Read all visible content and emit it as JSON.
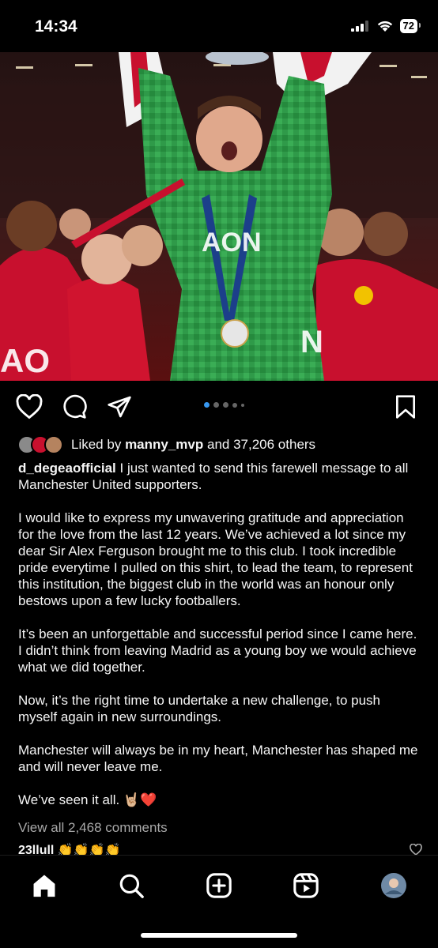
{
  "status_bar": {
    "time": "14:34",
    "battery": "72"
  },
  "post": {
    "image_alt": "Goalkeeper in green shirt lifting the trophy with teammates in red",
    "carousel": {
      "count": 5,
      "active_index": 0
    },
    "likes": {
      "prefix": "Liked by",
      "user": "manny_mvp",
      "suffix": "and 37,206 others"
    },
    "author": "d_degeaofficial",
    "caption_first": "I just wanted to send this farewell message to all Manchester United supporters.",
    "caption_paragraphs": [
      "I would like to express my unwavering gratitude and appreciation for the love from the last 12 years. We’ve achieved a lot since my dear Sir Alex Ferguson brought me to this club. I took incredible pride everytime I pulled on this shirt, to lead the team, to represent this institution, the biggest club in the world was an honour only bestows upon a few lucky footballers.",
      "It’s been an unforgettable and successful period since I came here. I didn’t think from leaving Madrid as a young boy we would achieve what we did together.",
      "Now, it’s the right time to undertake a new challenge, to push myself again in new surroundings.",
      "Manchester will always be in my heart, Manchester has shaped me and will never leave me.",
      "We’ve seen it all. 🤘🏼❤️"
    ],
    "view_comments": "View all 2,468 comments",
    "comment_preview": "23llull 👏👏👏👏"
  },
  "icons": {
    "like": "heart-icon",
    "comment": "comment-icon",
    "share": "send-icon",
    "save": "bookmark-icon",
    "nav": [
      "home-icon",
      "search-icon",
      "create-icon",
      "reels-icon",
      "profile-avatar"
    ]
  },
  "colors": {
    "accent": "#3797f0",
    "background": "#000000",
    "text": "#f5f5f5",
    "muted": "#a8a8a8"
  }
}
